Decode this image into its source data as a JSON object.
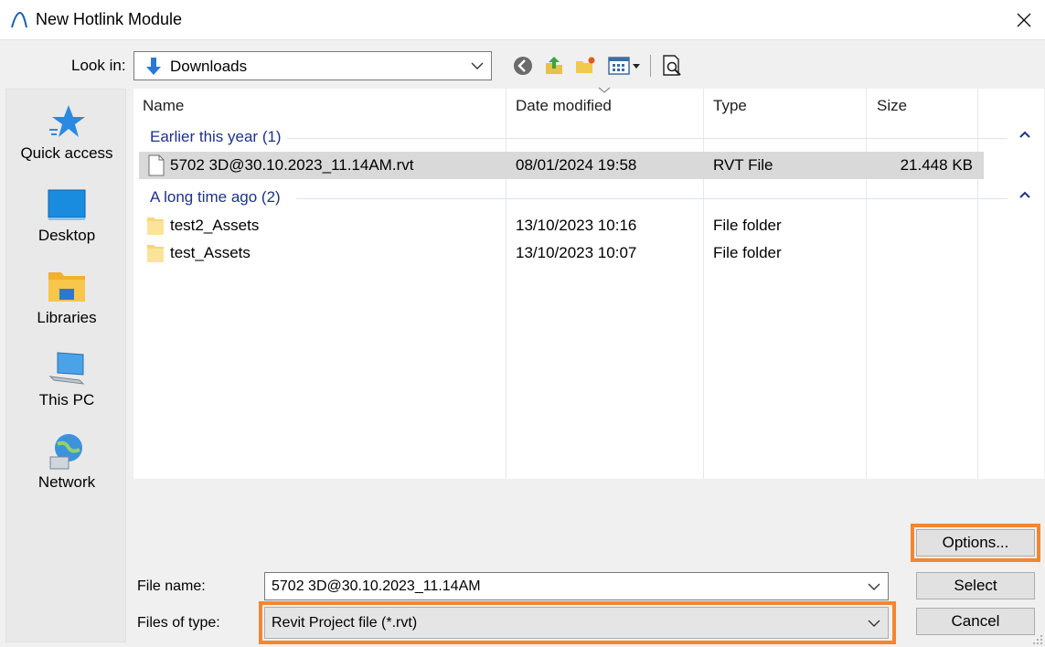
{
  "window": {
    "title": "New Hotlink Module"
  },
  "lookin": {
    "label": "Look in:",
    "value": "Downloads"
  },
  "places": [
    {
      "label": "Quick access",
      "icon": "quick-access-star-icon"
    },
    {
      "label": "Desktop",
      "icon": "desktop-icon"
    },
    {
      "label": "Libraries",
      "icon": "libraries-icon"
    },
    {
      "label": "This PC",
      "icon": "this-pc-icon"
    },
    {
      "label": "Network",
      "icon": "network-icon"
    }
  ],
  "columns": {
    "name": "Name",
    "date": "Date modified",
    "type": "Type",
    "size": "Size"
  },
  "groups": [
    {
      "title": "Earlier this year (1)",
      "items": [
        {
          "name": "5702 3D@30.10.2023_11.14AM.rvt",
          "date": "08/01/2024 19:58",
          "type": "RVT File",
          "size": "21.448 KB",
          "icon": "file-icon",
          "selected": true
        }
      ]
    },
    {
      "title": "A long time ago (2)",
      "items": [
        {
          "name": "test2_Assets",
          "date": "13/10/2023 10:16",
          "type": "File folder",
          "size": "",
          "icon": "folder-icon"
        },
        {
          "name": "test_Assets",
          "date": "13/10/2023 10:07",
          "type": "File folder",
          "size": "",
          "icon": "folder-icon"
        }
      ]
    }
  ],
  "filename": {
    "label": "File name:",
    "value": "5702 3D@30.10.2023_11.14AM"
  },
  "filetype": {
    "label": "Files of type:",
    "value": "Revit Project file (*.rvt)"
  },
  "buttons": {
    "options": "Options...",
    "select": "Select",
    "cancel": "Cancel"
  },
  "colors": {
    "highlight": "#f38630",
    "group_title": "#1e3287",
    "selection": "#d9d9d9"
  }
}
